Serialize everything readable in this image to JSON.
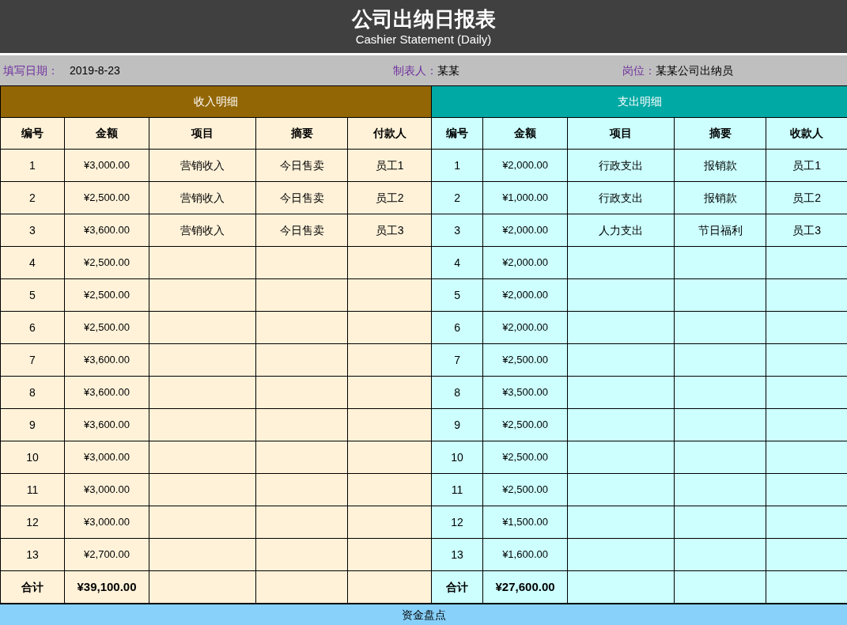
{
  "title": "公司出纳日报表",
  "subtitle": "Cashier Statement (Daily)",
  "info": [
    {
      "label": "填写日期：",
      "value": "2019-8-23"
    },
    {
      "label": "制表人：",
      "value": "某某"
    },
    {
      "label": "岗位：",
      "value": "某某公司出纳员"
    }
  ],
  "income": {
    "title": "收入明细",
    "columns": [
      "编号",
      "金额",
      "项目",
      "摘要",
      "付款人"
    ],
    "rows": [
      {
        "no": "1",
        "amount": "¥3,000.00",
        "item": "营销收入",
        "summary": "今日售卖",
        "party": "员工1"
      },
      {
        "no": "2",
        "amount": "¥2,500.00",
        "item": "营销收入",
        "summary": "今日售卖",
        "party": "员工2"
      },
      {
        "no": "3",
        "amount": "¥3,600.00",
        "item": "营销收入",
        "summary": "今日售卖",
        "party": "员工3"
      },
      {
        "no": "4",
        "amount": "¥2,500.00"
      },
      {
        "no": "5",
        "amount": "¥2,500.00"
      },
      {
        "no": "6",
        "amount": "¥2,500.00"
      },
      {
        "no": "7",
        "amount": "¥3,600.00"
      },
      {
        "no": "8",
        "amount": "¥3,600.00"
      },
      {
        "no": "9",
        "amount": "¥3,600.00"
      },
      {
        "no": "10",
        "amount": "¥3,000.00"
      },
      {
        "no": "11",
        "amount": "¥3,000.00"
      },
      {
        "no": "12",
        "amount": "¥3,000.00"
      },
      {
        "no": "13",
        "amount": "¥2,700.00"
      }
    ],
    "total": {
      "label": "合计",
      "amount": "¥39,100.00"
    }
  },
  "expense": {
    "title": "支出明细",
    "columns": [
      "编号",
      "金额",
      "项目",
      "摘要",
      "收款人"
    ],
    "rows": [
      {
        "no": "1",
        "amount": "¥2,000.00",
        "item": "行政支出",
        "summary": "报销款",
        "party": "员工1"
      },
      {
        "no": "2",
        "amount": "¥1,000.00",
        "item": "行政支出",
        "summary": "报销款",
        "party": "员工2"
      },
      {
        "no": "3",
        "amount": "¥2,000.00",
        "item": "人力支出",
        "summary": "节日福利",
        "party": "员工3"
      },
      {
        "no": "4",
        "amount": "¥2,000.00"
      },
      {
        "no": "5",
        "amount": "¥2,000.00"
      },
      {
        "no": "6",
        "amount": "¥2,000.00"
      },
      {
        "no": "7",
        "amount": "¥2,500.00"
      },
      {
        "no": "8",
        "amount": "¥3,500.00"
      },
      {
        "no": "9",
        "amount": "¥2,500.00"
      },
      {
        "no": "10",
        "amount": "¥2,500.00"
      },
      {
        "no": "11",
        "amount": "¥2,500.00"
      },
      {
        "no": "12",
        "amount": "¥1,500.00"
      },
      {
        "no": "13",
        "amount": "¥1,600.00"
      }
    ],
    "total": {
      "label": "合计",
      "amount": "¥27,600.00"
    }
  },
  "footer": "资金盘点"
}
